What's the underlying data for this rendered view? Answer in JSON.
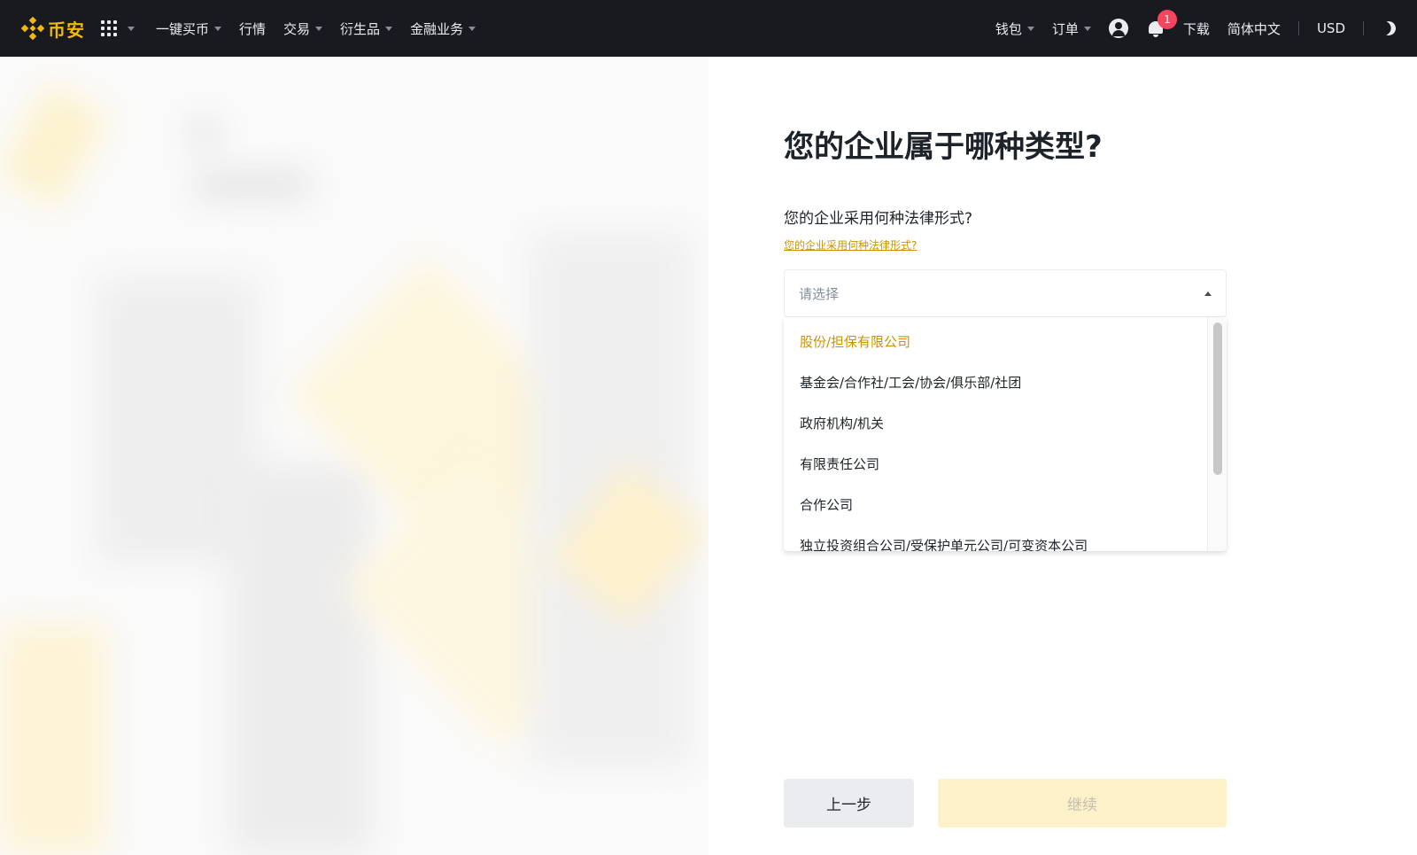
{
  "topbar": {
    "brand": "币安",
    "nav": [
      {
        "label": "一键买币",
        "has_caret": true
      },
      {
        "label": "行情",
        "has_caret": false
      },
      {
        "label": "交易",
        "has_caret": true
      },
      {
        "label": "衍生品",
        "has_caret": true
      },
      {
        "label": "金融业务",
        "has_caret": true
      }
    ],
    "wallet": "钱包",
    "orders": "订单",
    "notification_count": "1",
    "download": "下载",
    "language": "简体中文",
    "currency": "USD"
  },
  "form": {
    "title": "您的企业属于哪种类型?",
    "question": "您的企业采用何种法律形式?",
    "help_link": "您的企业采用何种法律形式?",
    "select_placeholder": "请选择",
    "options": [
      {
        "label": "股份/担保有限公司",
        "active": true
      },
      {
        "label": "基金会/合作社/工会/协会/俱乐部/社团",
        "active": false
      },
      {
        "label": "政府机构/机关",
        "active": false
      },
      {
        "label": "有限责任公司",
        "active": false
      },
      {
        "label": "合作公司",
        "active": false
      },
      {
        "label": "独立投资组合公司/受保护单元公司/可变资本公司",
        "active": false
      }
    ],
    "back_label": "上一步",
    "continue_label": "继续"
  },
  "colors": {
    "brand_yellow": "#F0B90B",
    "topbar_bg": "#181A20",
    "active_option": "#C99400",
    "badge_red": "#F6465D",
    "disabled_continue_bg": "#FCF1C8"
  }
}
